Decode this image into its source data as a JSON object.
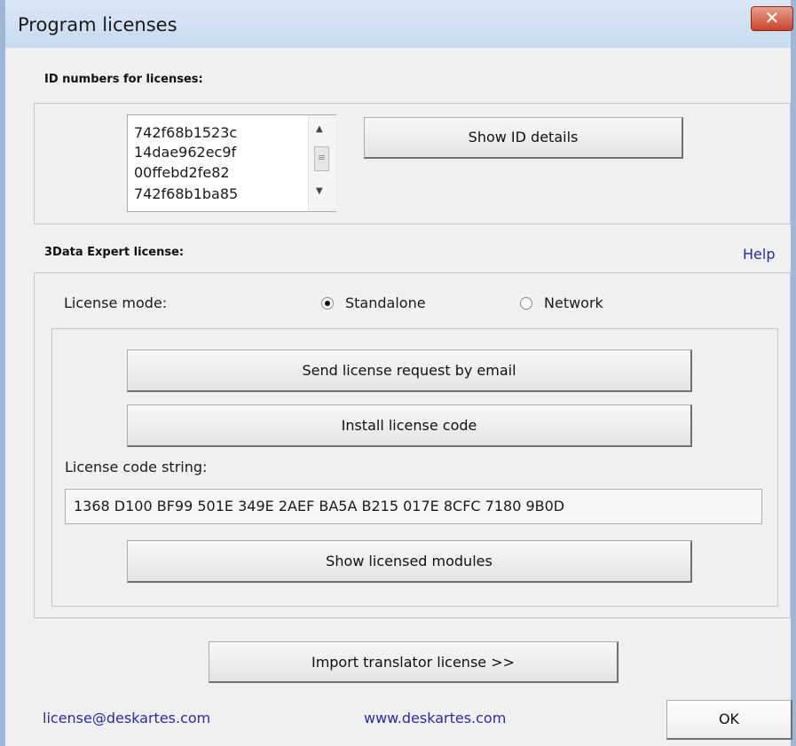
{
  "window": {
    "title": "Program licenses",
    "close_glyph": "✕"
  },
  "id_section": {
    "label": "ID numbers for licenses:",
    "ids": [
      "742f68b1523c",
      "14dae962ec9f",
      "00ffebd2fe82",
      "742f68b1ba85"
    ],
    "show_details_label": "Show ID details"
  },
  "expert_section": {
    "label": "3Data Expert license:",
    "help_label": "Help",
    "license_mode_label": "License mode:",
    "modes": [
      {
        "label": "Standalone",
        "selected": true
      },
      {
        "label": "Network",
        "selected": false
      }
    ],
    "send_request_label": "Send license request by email",
    "install_code_label": "Install license code",
    "code_string_label": "License code string:",
    "code_string_value": "1368 D100 BF99 501E 349E 2AEF BA5A B215 017E 8CFC 7180 9B0D",
    "show_modules_label": "Show licensed modules"
  },
  "import_translator_label": "Import translator license >>",
  "footer": {
    "email_link": "license@deskartes.com",
    "web_link": "www.deskartes.com",
    "ok_label": "OK"
  },
  "colors": {
    "link": "#2a2aa8",
    "titlebar": "#c8daf0",
    "close": "#c7432b"
  }
}
